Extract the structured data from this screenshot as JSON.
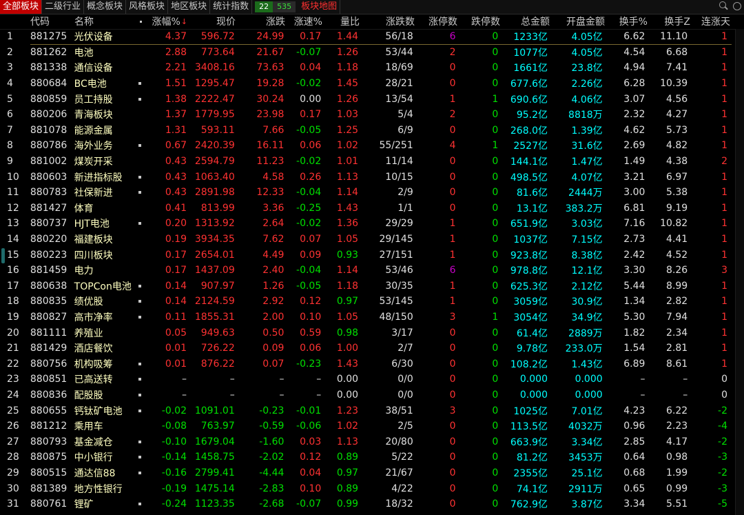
{
  "tabs": [
    {
      "label": "全部板块",
      "active": true
    },
    {
      "label": "二级行业"
    },
    {
      "label": "概念板块"
    },
    {
      "label": "风格板块"
    },
    {
      "label": "地区板块"
    },
    {
      "label": "统计指数"
    }
  ],
  "updown": {
    "up": "22",
    "down": "535"
  },
  "map_tab": "板块地图",
  "icons": {
    "search": "search-icon",
    "zoom": "zoom-icon"
  },
  "columns": [
    "代码",
    "名称",
    "",
    "涨幅%",
    "现价",
    "涨跌",
    "涨速%",
    "量比",
    "涨跌数",
    "涨停数",
    "跌停数",
    "总金额",
    "开盘金额",
    "换手%",
    "换手Z",
    "连涨天"
  ],
  "sort_arrow": "↓",
  "rows": [
    {
      "i": "1",
      "code": "881275",
      "name": "光伏设备",
      "dot": false,
      "pct": "4.37",
      "price": "596.72",
      "chg": "24.99",
      "spd": "0.17",
      "vol": "1.44",
      "ud": "56/18",
      "lu": "6",
      "ld": "0",
      "amt": "1233亿",
      "open": "4.05亿",
      "turn": "6.62",
      "turnz": "11.10",
      "days": "1"
    },
    {
      "i": "2",
      "code": "881262",
      "name": "电池",
      "dot": false,
      "pct": "2.88",
      "price": "773.64",
      "chg": "21.67",
      "spd": "-0.07",
      "vol": "1.26",
      "ud": "53/44",
      "lu": "2",
      "ld": "0",
      "amt": "1077亿",
      "open": "4.05亿",
      "turn": "4.54",
      "turnz": "6.68",
      "days": "1"
    },
    {
      "i": "3",
      "code": "881338",
      "name": "通信设备",
      "dot": false,
      "pct": "2.21",
      "price": "3408.16",
      "chg": "73.63",
      "spd": "0.04",
      "vol": "1.18",
      "ud": "18/69",
      "lu": "0",
      "ld": "0",
      "amt": "1661亿",
      "open": "23.8亿",
      "turn": "4.94",
      "turnz": "7.41",
      "days": "1"
    },
    {
      "i": "4",
      "code": "880684",
      "name": "BC电池",
      "dot": true,
      "pct": "1.51",
      "price": "1295.47",
      "chg": "19.28",
      "spd": "-0.02",
      "vol": "1.45",
      "ud": "28/21",
      "lu": "0",
      "ld": "0",
      "amt": "677.6亿",
      "open": "2.26亿",
      "turn": "6.28",
      "turnz": "10.39",
      "days": "1"
    },
    {
      "i": "5",
      "code": "880859",
      "name": "员工持股",
      "dot": true,
      "pct": "1.38",
      "price": "2222.47",
      "chg": "30.24",
      "spd": "0.00",
      "vol": "1.26",
      "ud": "13/54",
      "lu": "1",
      "ld": "1",
      "amt": "690.6亿",
      "open": "4.06亿",
      "turn": "3.07",
      "turnz": "4.56",
      "days": "1"
    },
    {
      "i": "6",
      "code": "880206",
      "name": "青海板块",
      "dot": false,
      "pct": "1.37",
      "price": "1779.95",
      "chg": "23.98",
      "spd": "0.17",
      "vol": "1.03",
      "ud": "5/4",
      "lu": "2",
      "ld": "0",
      "amt": "95.2亿",
      "open": "8818万",
      "turn": "2.32",
      "turnz": "4.27",
      "days": "1"
    },
    {
      "i": "7",
      "code": "881078",
      "name": "能源金属",
      "dot": false,
      "pct": "1.31",
      "price": "593.11",
      "chg": "7.66",
      "spd": "-0.05",
      "vol": "1.25",
      "ud": "6/9",
      "lu": "0",
      "ld": "0",
      "amt": "268.0亿",
      "open": "1.39亿",
      "turn": "4.62",
      "turnz": "5.73",
      "days": "1"
    },
    {
      "i": "8",
      "code": "880786",
      "name": "海外业务",
      "dot": true,
      "pct": "0.67",
      "price": "2420.39",
      "chg": "16.11",
      "spd": "0.06",
      "vol": "1.02",
      "ud": "55/251",
      "lu": "4",
      "ld": "1",
      "amt": "2527亿",
      "open": "31.6亿",
      "turn": "2.69",
      "turnz": "4.82",
      "days": "1"
    },
    {
      "i": "9",
      "code": "881002",
      "name": "煤炭开采",
      "dot": false,
      "pct": "0.43",
      "price": "2594.79",
      "chg": "11.23",
      "spd": "-0.02",
      "vol": "1.01",
      "ud": "11/14",
      "lu": "0",
      "ld": "0",
      "amt": "144.1亿",
      "open": "1.47亿",
      "turn": "1.49",
      "turnz": "4.38",
      "days": "2"
    },
    {
      "i": "10",
      "code": "880603",
      "name": "新进指标股",
      "dot": true,
      "pct": "0.43",
      "price": "1063.40",
      "chg": "4.58",
      "spd": "0.26",
      "vol": "1.13",
      "ud": "10/15",
      "lu": "0",
      "ld": "0",
      "amt": "498.5亿",
      "open": "4.07亿",
      "turn": "3.21",
      "turnz": "6.97",
      "days": "1"
    },
    {
      "i": "11",
      "code": "880783",
      "name": "社保新进",
      "dot": true,
      "pct": "0.43",
      "price": "2891.98",
      "chg": "12.33",
      "spd": "-0.04",
      "vol": "1.14",
      "ud": "2/9",
      "lu": "0",
      "ld": "0",
      "amt": "81.6亿",
      "open": "2444万",
      "turn": "3.00",
      "turnz": "5.38",
      "days": "1"
    },
    {
      "i": "12",
      "code": "881427",
      "name": "体育",
      "dot": false,
      "pct": "0.41",
      "price": "813.99",
      "chg": "3.36",
      "spd": "-0.25",
      "vol": "1.43",
      "ud": "1/1",
      "lu": "0",
      "ld": "0",
      "amt": "13.1亿",
      "open": "383.2万",
      "turn": "6.81",
      "turnz": "9.19",
      "days": "1"
    },
    {
      "i": "13",
      "code": "880737",
      "name": "HJT电池",
      "dot": true,
      "pct": "0.20",
      "price": "1313.92",
      "chg": "2.64",
      "spd": "-0.02",
      "vol": "1.36",
      "ud": "29/29",
      "lu": "1",
      "ld": "0",
      "amt": "651.9亿",
      "open": "3.03亿",
      "turn": "7.16",
      "turnz": "10.82",
      "days": "1"
    },
    {
      "i": "14",
      "code": "880220",
      "name": "福建板块",
      "dot": false,
      "pct": "0.19",
      "price": "3934.35",
      "chg": "7.62",
      "spd": "0.07",
      "vol": "1.05",
      "ud": "29/145",
      "lu": "1",
      "ld": "0",
      "amt": "1037亿",
      "open": "7.15亿",
      "turn": "2.73",
      "turnz": "4.41",
      "days": "1"
    },
    {
      "i": "15",
      "code": "880223",
      "name": "四川板块",
      "dot": false,
      "pct": "0.17",
      "price": "2654.01",
      "chg": "4.49",
      "spd": "0.09",
      "vol": "0.93",
      "ud": "27/151",
      "lu": "1",
      "ld": "0",
      "amt": "923.8亿",
      "open": "8.38亿",
      "turn": "2.42",
      "turnz": "4.52",
      "days": "1"
    },
    {
      "i": "16",
      "code": "881459",
      "name": "电力",
      "dot": false,
      "pct": "0.17",
      "price": "1437.09",
      "chg": "2.40",
      "spd": "-0.04",
      "vol": "1.14",
      "ud": "53/46",
      "lu": "6",
      "ld": "0",
      "amt": "978.8亿",
      "open": "12.1亿",
      "turn": "3.30",
      "turnz": "8.26",
      "days": "3"
    },
    {
      "i": "17",
      "code": "880638",
      "name": "TOPCon电池",
      "dot": true,
      "pct": "0.14",
      "price": "907.97",
      "chg": "1.26",
      "spd": "-0.05",
      "vol": "1.18",
      "ud": "30/35",
      "lu": "1",
      "ld": "0",
      "amt": "625.3亿",
      "open": "2.12亿",
      "turn": "5.44",
      "turnz": "8.99",
      "days": "1"
    },
    {
      "i": "18",
      "code": "880835",
      "name": "绩优股",
      "dot": true,
      "pct": "0.14",
      "price": "2124.59",
      "chg": "2.92",
      "spd": "0.12",
      "vol": "0.97",
      "ud": "53/145",
      "lu": "1",
      "ld": "0",
      "amt": "3059亿",
      "open": "30.9亿",
      "turn": "1.34",
      "turnz": "2.82",
      "days": "1"
    },
    {
      "i": "19",
      "code": "880827",
      "name": "高市净率",
      "dot": true,
      "pct": "0.11",
      "price": "1855.31",
      "chg": "2.00",
      "spd": "0.10",
      "vol": "1.05",
      "ud": "48/150",
      "lu": "3",
      "ld": "1",
      "amt": "3054亿",
      "open": "34.9亿",
      "turn": "5.30",
      "turnz": "7.94",
      "days": "1"
    },
    {
      "i": "20",
      "code": "881111",
      "name": "养殖业",
      "dot": false,
      "pct": "0.05",
      "price": "949.63",
      "chg": "0.50",
      "spd": "0.59",
      "vol": "0.98",
      "ud": "3/17",
      "lu": "0",
      "ld": "0",
      "amt": "61.4亿",
      "open": "2889万",
      "turn": "1.82",
      "turnz": "2.34",
      "days": "1"
    },
    {
      "i": "21",
      "code": "881429",
      "name": "酒店餐饮",
      "dot": false,
      "pct": "0.01",
      "price": "726.22",
      "chg": "0.09",
      "spd": "0.06",
      "vol": "1.00",
      "ud": "2/7",
      "lu": "0",
      "ld": "0",
      "amt": "9.78亿",
      "open": "233.0万",
      "turn": "1.54",
      "turnz": "2.81",
      "days": "1"
    },
    {
      "i": "22",
      "code": "880756",
      "name": "机构吸筹",
      "dot": true,
      "pct": "0.01",
      "price": "876.22",
      "chg": "0.07",
      "spd": "-0.23",
      "vol": "1.43",
      "ud": "6/30",
      "lu": "0",
      "ld": "0",
      "amt": "108.2亿",
      "open": "1.43亿",
      "turn": "6.89",
      "turnz": "8.61",
      "days": "1"
    },
    {
      "i": "23",
      "code": "880851",
      "name": "已高送转",
      "dot": true,
      "pct": "–",
      "price": "–",
      "chg": "–",
      "spd": "–",
      "vol": "0.00",
      "ud": "0/0",
      "lu": "0",
      "ld": "0",
      "amt": "0.000",
      "open": "0.000",
      "turn": "–",
      "turnz": "–",
      "days": "0"
    },
    {
      "i": "24",
      "code": "880836",
      "name": "配股股",
      "dot": true,
      "pct": "–",
      "price": "–",
      "chg": "–",
      "spd": "–",
      "vol": "0.00",
      "ud": "0/0",
      "lu": "0",
      "ld": "0",
      "amt": "0.000",
      "open": "0.000",
      "turn": "–",
      "turnz": "–",
      "days": "0"
    },
    {
      "i": "25",
      "code": "880655",
      "name": "钙钛矿电池",
      "dot": true,
      "pct": "-0.02",
      "price": "1091.01",
      "chg": "-0.23",
      "spd": "-0.01",
      "vol": "1.23",
      "ud": "38/51",
      "lu": "3",
      "ld": "0",
      "amt": "1025亿",
      "open": "7.01亿",
      "turn": "4.23",
      "turnz": "6.22",
      "days": "-2"
    },
    {
      "i": "26",
      "code": "881212",
      "name": "乘用车",
      "dot": false,
      "pct": "-0.08",
      "price": "763.97",
      "chg": "-0.59",
      "spd": "-0.06",
      "vol": "1.02",
      "ud": "2/5",
      "lu": "0",
      "ld": "0",
      "amt": "113.5亿",
      "open": "4032万",
      "turn": "0.96",
      "turnz": "2.23",
      "days": "-4"
    },
    {
      "i": "27",
      "code": "880793",
      "name": "基金减仓",
      "dot": true,
      "pct": "-0.10",
      "price": "1679.04",
      "chg": "-1.60",
      "spd": "0.03",
      "vol": "1.13",
      "ud": "20/80",
      "lu": "0",
      "ld": "0",
      "amt": "663.9亿",
      "open": "3.34亿",
      "turn": "2.85",
      "turnz": "4.17",
      "days": "-2"
    },
    {
      "i": "28",
      "code": "880875",
      "name": "中小银行",
      "dot": true,
      "pct": "-0.14",
      "price": "1458.75",
      "chg": "-2.02",
      "spd": "0.12",
      "vol": "0.89",
      "ud": "5/22",
      "lu": "0",
      "ld": "0",
      "amt": "81.2亿",
      "open": "3453万",
      "turn": "0.64",
      "turnz": "0.98",
      "days": "-3"
    },
    {
      "i": "29",
      "code": "880515",
      "name": "通达信88",
      "dot": true,
      "pct": "-0.16",
      "price": "2799.41",
      "chg": "-4.44",
      "spd": "0.04",
      "vol": "0.97",
      "ud": "21/67",
      "lu": "0",
      "ld": "0",
      "amt": "2355亿",
      "open": "25.1亿",
      "turn": "0.68",
      "turnz": "1.99",
      "days": "-2"
    },
    {
      "i": "30",
      "code": "881389",
      "name": "地方性银行",
      "dot": false,
      "pct": "-0.19",
      "price": "1475.14",
      "chg": "-2.83",
      "spd": "0.10",
      "vol": "0.89",
      "ud": "4/22",
      "lu": "0",
      "ld": "0",
      "amt": "74.1亿",
      "open": "2911万",
      "turn": "0.65",
      "turnz": "0.99",
      "days": "-3"
    },
    {
      "i": "31",
      "code": "880761",
      "name": "锂矿",
      "dot": true,
      "pct": "-0.24",
      "price": "1123.35",
      "chg": "-2.68",
      "spd": "-0.07",
      "vol": "0.99",
      "ud": "18/32",
      "lu": "0",
      "ld": "0",
      "amt": "762.9亿",
      "open": "3.87亿",
      "turn": "3.34",
      "turnz": "5.51",
      "days": "-5"
    }
  ]
}
